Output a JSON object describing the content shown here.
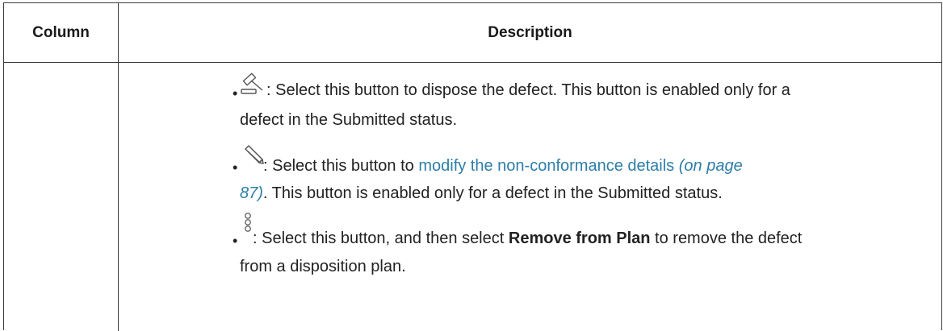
{
  "table": {
    "headers": {
      "column": "Column",
      "description": "Description"
    },
    "items": [
      {
        "icon": "gavel-icon",
        "line1": ": Select this button to dispose the defect. This button is enabled only for a",
        "line2": "defect in the Submitted status."
      },
      {
        "icon": "pencil-icon",
        "line1_prefix": ": Select this button to ",
        "link_text": "modify the non-conformance details",
        "link_page": "(on page",
        "link_page_2": "87)",
        "line2_suffix": ". This button is enabled only for a defect in the Submitted status."
      },
      {
        "icon": "more-vertical-icon",
        "line1_prefix": ": Select this button, and then select ",
        "bold_text": "Remove from Plan",
        "line1_suffix": " to remove the defect",
        "line2": "from a disposition plan."
      }
    ]
  }
}
